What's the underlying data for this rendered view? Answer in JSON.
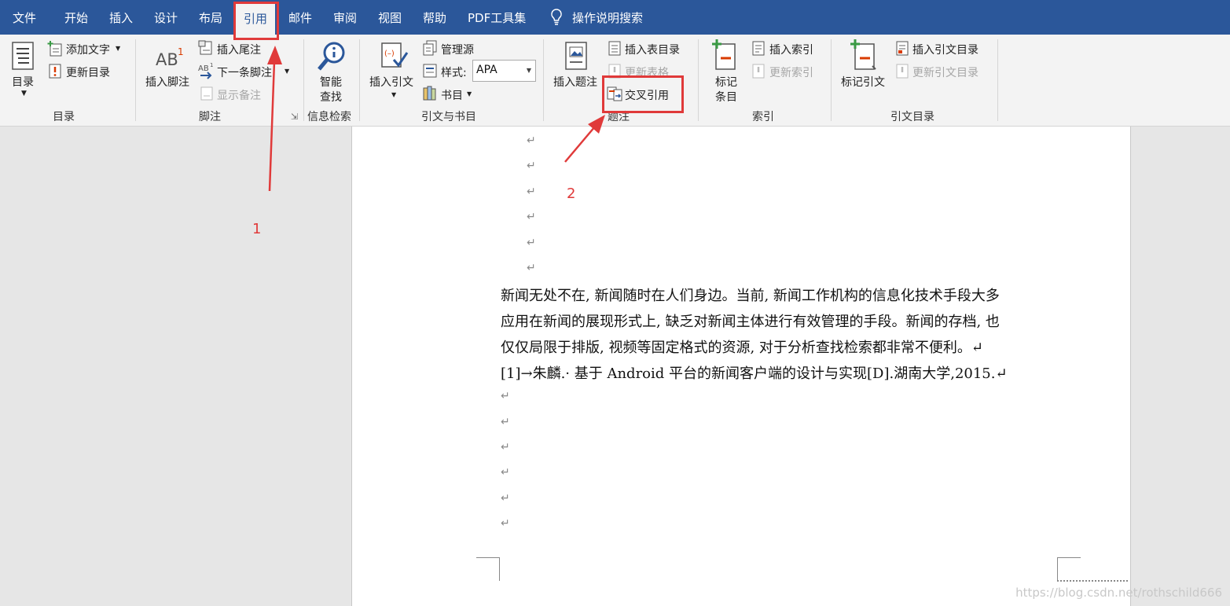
{
  "menu": {
    "tabs": [
      "文件",
      "开始",
      "插入",
      "设计",
      "布局",
      "引用",
      "邮件",
      "审阅",
      "视图",
      "帮助",
      "PDF工具集"
    ],
    "active": "引用",
    "search": "操作说明搜索"
  },
  "ribbon": {
    "toc": {
      "toc_button": "目录",
      "add_text": "添加文字",
      "update_toc": "更新目录",
      "group": "目录"
    },
    "footnotes": {
      "insert_footnote": "插入脚注",
      "insert_endnote": "插入尾注",
      "next_footnote": "下一条脚注",
      "show_notes": "显示备注",
      "group": "脚注"
    },
    "research": {
      "smart_lookup_1": "智能",
      "smart_lookup_2": "查找",
      "group": "信息检索"
    },
    "citations": {
      "insert_citation": "插入引文",
      "manage_sources": "管理源",
      "style_label": "样式:",
      "style_value": "APA",
      "bibliography": "书目",
      "group": "引文与书目"
    },
    "captions": {
      "insert_caption": "插入题注",
      "insert_tof": "插入表目录",
      "update_table": "更新表格",
      "cross_reference": "交叉引用",
      "group": "题注"
    },
    "index": {
      "mark_entry_1": "标记",
      "mark_entry_2": "条目",
      "insert_index": "插入索引",
      "update_index": "更新索引",
      "group": "索引"
    },
    "toa": {
      "mark_citation": "标记引文",
      "insert_toa": "插入引文目录",
      "update_toa": "更新引文目录",
      "group": "引文目录"
    }
  },
  "document": {
    "para_lines": [
      "新闻无处不在, 新闻随时在人们身边。当前, 新闻工作机构的信息化技术手段大多",
      "应用在新闻的展现形式上, 缺乏对新闻主体进行有效管理的手段。新闻的存档, 也",
      "仅仅局限于排版, 视频等固定格式的资源, 对于分析查找检索都非常不便利。↵"
    ],
    "reference": "[1]→朱麟.· 基于 Android 平台的新闻客户端的设计与实现[D].湖南大学,2015.↵",
    "pilcrow": "↵"
  },
  "annotations": {
    "step1": "1",
    "step2": "2"
  },
  "watermark": "https://blog.csdn.net/rothschild666",
  "colors": {
    "ribbon_bar": "#2b579a",
    "callout": "#e03a3a"
  }
}
